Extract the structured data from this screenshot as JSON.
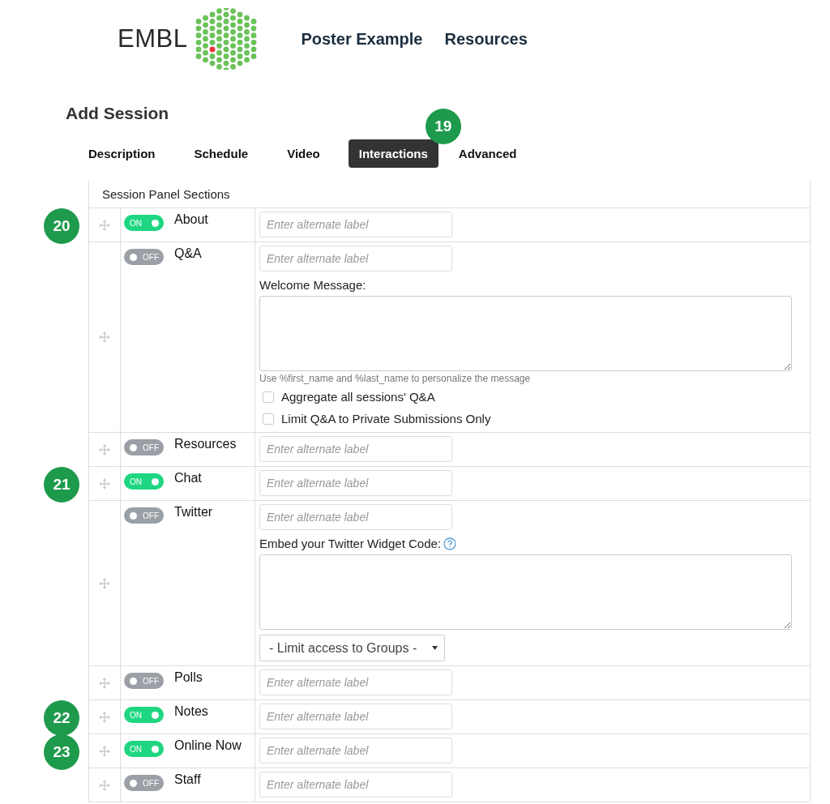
{
  "header": {
    "logo_text": "EMBL",
    "nav": [
      "Poster Example",
      "Resources"
    ]
  },
  "page_title": "Add Session",
  "tabs": [
    {
      "label": "Description",
      "selected": false
    },
    {
      "label": "Schedule",
      "selected": false
    },
    {
      "label": "Video",
      "selected": false
    },
    {
      "label": "Interactions",
      "selected": true,
      "badge": "19"
    },
    {
      "label": "Advanced",
      "selected": false
    }
  ],
  "table": {
    "heading": "Session Panel Sections",
    "rows": [
      {
        "kind": "simple",
        "badge": "20",
        "on": true,
        "toggle_text": "ON",
        "label": "About",
        "placeholder": "Enter alternate label"
      },
      {
        "kind": "qa",
        "on": false,
        "toggle_text": "OFF",
        "label": "Q&A",
        "placeholder": "Enter alternate label",
        "message_label": "Welcome Message:",
        "hint": "Use %first_name and %last_name to personalize the message",
        "checkboxes": [
          {
            "label": "Aggregate all sessions' Q&A",
            "checked": false
          },
          {
            "label": "Limit Q&A to Private Submissions Only",
            "checked": false
          }
        ]
      },
      {
        "kind": "simple",
        "on": false,
        "toggle_text": "OFF",
        "label": "Resources",
        "placeholder": "Enter alternate label"
      },
      {
        "kind": "simple",
        "badge": "21",
        "on": true,
        "toggle_text": "ON",
        "label": "Chat",
        "placeholder": "Enter alternate label"
      },
      {
        "kind": "twitter",
        "on": false,
        "toggle_text": "OFF",
        "label": "Twitter",
        "placeholder": "Enter alternate label",
        "message_label": "Embed your Twitter Widget Code:",
        "select": "- Limit access to Groups -"
      },
      {
        "kind": "simple",
        "on": false,
        "toggle_text": "OFF",
        "label": "Polls",
        "placeholder": "Enter alternate label"
      },
      {
        "kind": "simple",
        "badge": "22",
        "on": true,
        "toggle_text": "ON",
        "label": "Notes",
        "placeholder": "Enter alternate label"
      },
      {
        "kind": "simple",
        "badge": "23",
        "on": true,
        "toggle_text": "ON",
        "label": "Online Now",
        "placeholder": "Enter alternate label"
      },
      {
        "kind": "simple",
        "on": false,
        "toggle_text": "OFF",
        "label": "Staff",
        "placeholder": "Enter alternate label"
      }
    ]
  }
}
